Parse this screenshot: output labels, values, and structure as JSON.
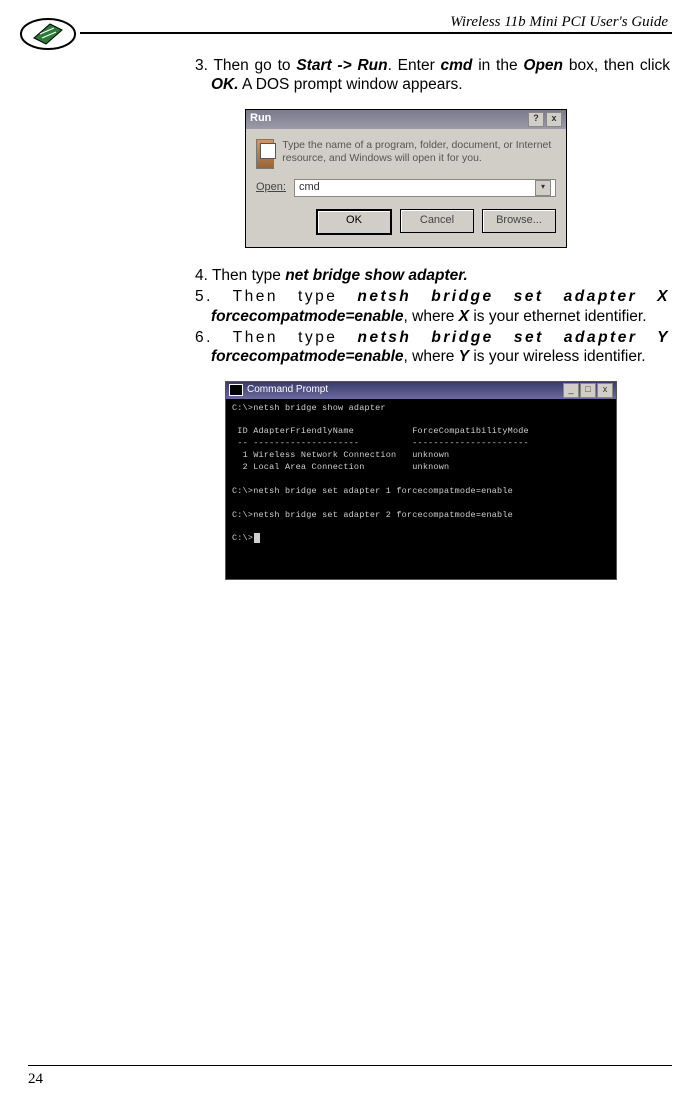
{
  "header": {
    "title": "Wireless 11b Mini PCI  User's Guide"
  },
  "page_number": "24",
  "steps": {
    "s3_a": "3. Then go to ",
    "s3_b": "Start -> Run",
    "s3_c": ". Enter ",
    "s3_d": "cmd",
    "s3_e": " in the ",
    "s3_f": "Open",
    "s3_g": " box, then click ",
    "s3_h": "OK.",
    "s3_i": " A DOS prompt window appears.",
    "s4_a": "4. Then type ",
    "s4_b": "net bridge show adapter.",
    "s5_a": "5. Then type ",
    "s5_b": "netsh bridge set adapter X",
    "s5_c": " ",
    "s5_d": "forcecompatmode=enable",
    "s5_e": ", where ",
    "s5_f": "X",
    "s5_g": " is your ethernet identifier.",
    "s6_a": "6. Then type ",
    "s6_b": "netsh bridge set adapter Y",
    "s6_c": " ",
    "s6_d": "forcecompatmode=enable",
    "s6_e": ", where ",
    "s6_f": "Y",
    "s6_g": " is your wireless identifier."
  },
  "run_dialog": {
    "title": "Run",
    "help": "?",
    "close": "x",
    "description": "Type the name of a program, folder, document, or Internet resource, and Windows will open it for you.",
    "open_label": "Open:",
    "input_value": "cmd",
    "ok": "OK",
    "cancel": "Cancel",
    "browse": "Browse..."
  },
  "cmd": {
    "title": "Command Prompt",
    "min": "_",
    "max": "□",
    "close": "x",
    "line1": "C:\\>netsh bridge show adapter",
    "line2": " ID AdapterFriendlyName           ForceCompatibilityMode",
    "line3": " -- --------------------          ----------------------",
    "line4": "  1 Wireless Network Connection   unknown",
    "line5": "  2 Local Area Connection         unknown",
    "line6": "C:\\>netsh bridge set adapter 1 forcecompatmode=enable",
    "line7": "C:\\>netsh bridge set adapter 2 forcecompatmode=enable",
    "line8": "C:\\>"
  }
}
